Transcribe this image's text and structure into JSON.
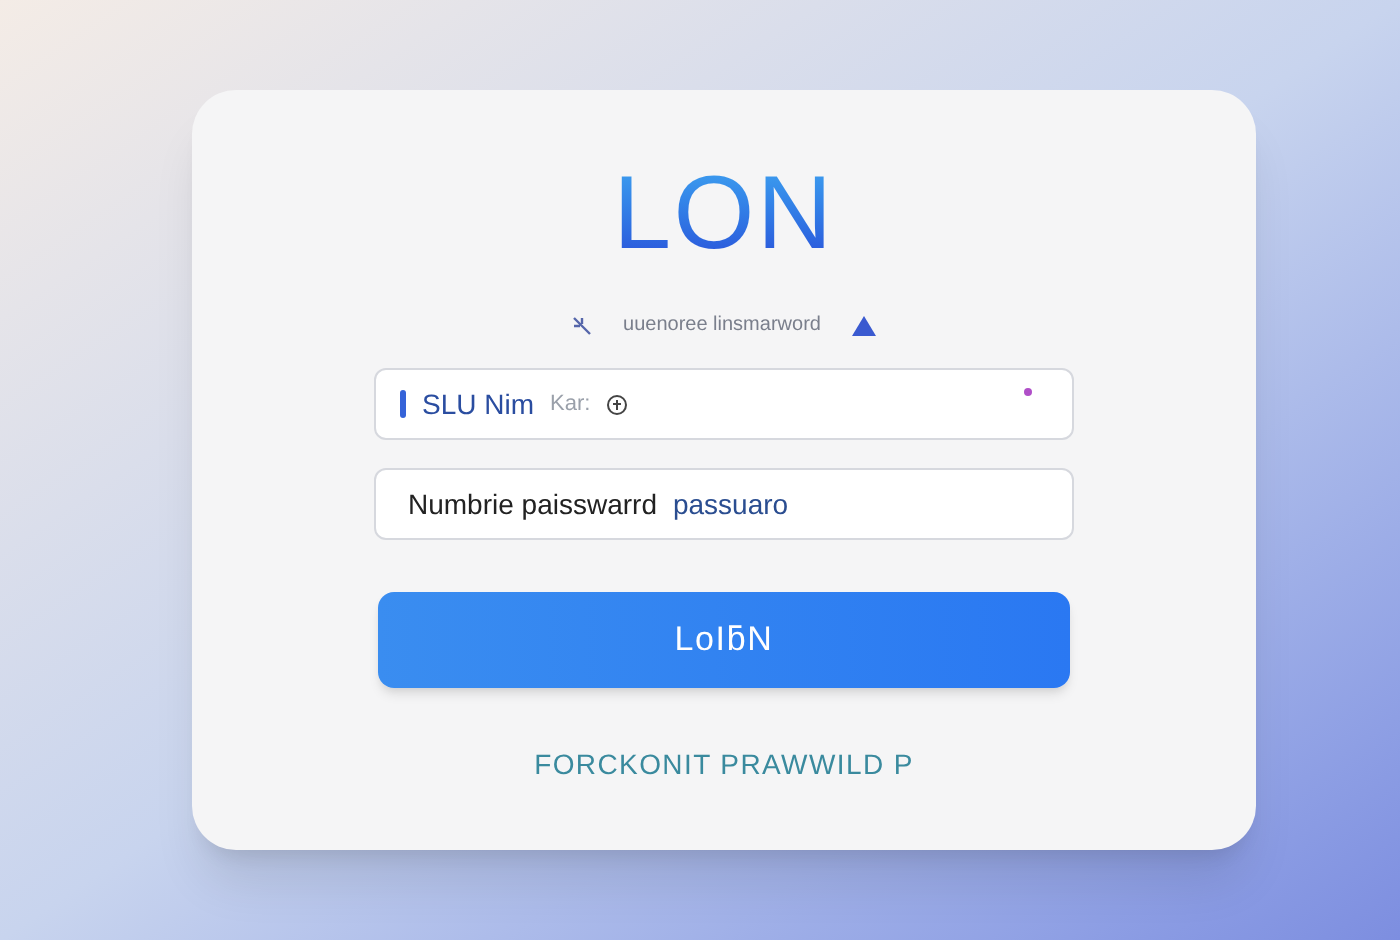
{
  "title": "LON",
  "subtitle": "uuenoree linsmarword",
  "username": {
    "value": "SLU Nim",
    "hint": "Kar:",
    "focused": true
  },
  "password": {
    "value": "Numbrie paisswarrd",
    "suffix": "passuaro"
  },
  "login_button": "LoIƃN",
  "forgot_link": "FORCKONIT PRAWWILD P"
}
